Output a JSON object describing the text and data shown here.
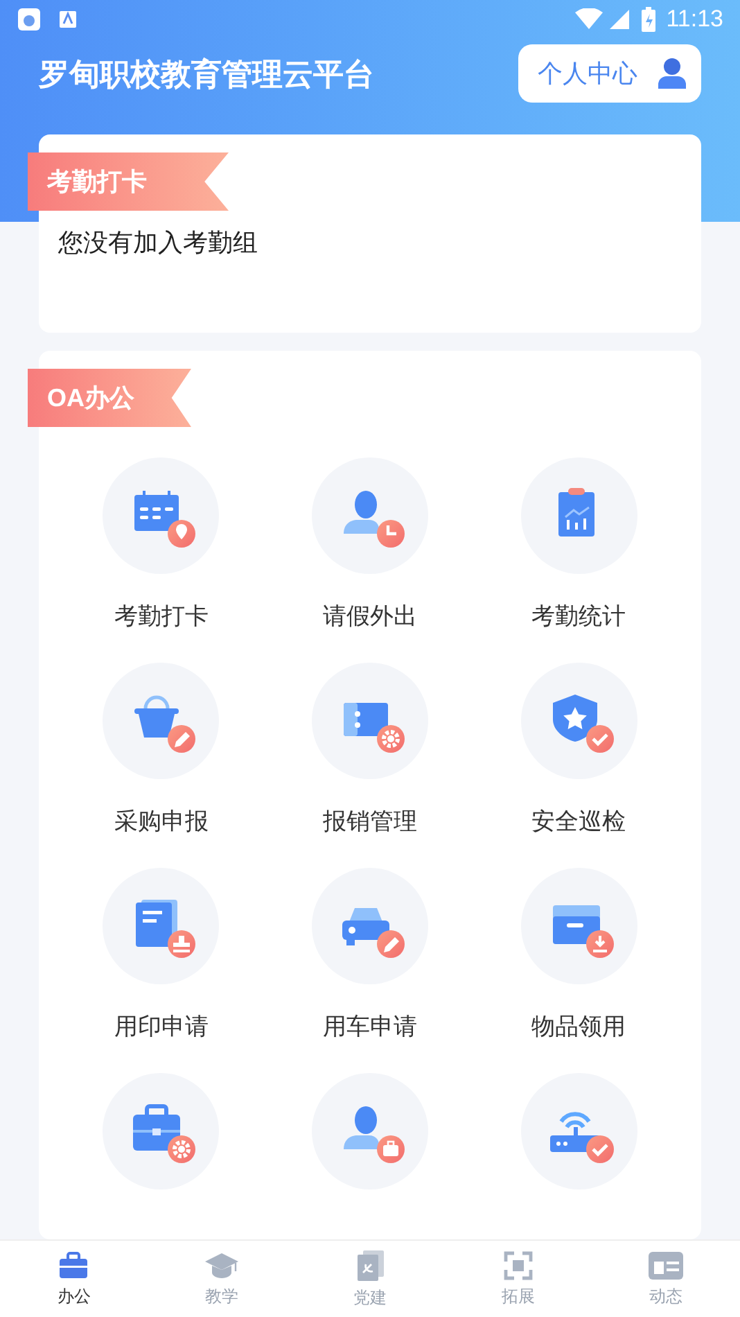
{
  "status_bar": {
    "time": "11:13"
  },
  "header": {
    "title": "罗甸职校教育管理云平台",
    "profile_button": "个人中心"
  },
  "attendance": {
    "tag": "考勤打卡",
    "message": "您没有加入考勤组"
  },
  "oa": {
    "tag": "OA办公",
    "items": [
      {
        "kind": "calendar",
        "label": "考勤打卡"
      },
      {
        "kind": "leave",
        "label": "请假外出"
      },
      {
        "kind": "stats",
        "label": "考勤统计"
      },
      {
        "kind": "basket",
        "label": "采购申报"
      },
      {
        "kind": "ticket",
        "label": "报销管理"
      },
      {
        "kind": "shield",
        "label": "安全巡检"
      },
      {
        "kind": "stamp",
        "label": "用印申请"
      },
      {
        "kind": "car",
        "label": "用车申请"
      },
      {
        "kind": "box",
        "label": "物品领用"
      },
      {
        "kind": "briefcase"
      },
      {
        "kind": "staff"
      },
      {
        "kind": "router"
      }
    ]
  },
  "tabs": [
    {
      "kind": "office",
      "label": "办公",
      "selected": true
    },
    {
      "kind": "teach",
      "label": "教学",
      "selected": false
    },
    {
      "kind": "party",
      "label": "党建",
      "selected": false
    },
    {
      "kind": "expand",
      "label": "拓展",
      "selected": false
    },
    {
      "kind": "news",
      "label": "动态",
      "selected": false
    }
  ]
}
